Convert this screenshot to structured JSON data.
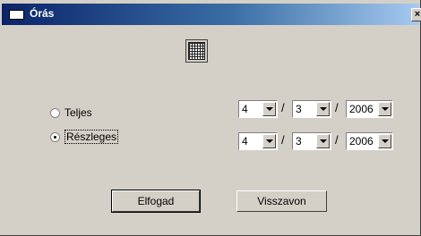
{
  "window": {
    "title": "Órás",
    "close_label": "×"
  },
  "options": [
    {
      "label": "Teljes",
      "checked": false
    },
    {
      "label": "Részleges",
      "checked": true
    }
  ],
  "date_rows": [
    {
      "day": "4",
      "month": "3",
      "year": "2006"
    },
    {
      "day": "4",
      "month": "3",
      "year": "2006"
    }
  ],
  "separator": "/",
  "buttons": {
    "accept": "Elfogad",
    "cancel": "Visszavon"
  }
}
